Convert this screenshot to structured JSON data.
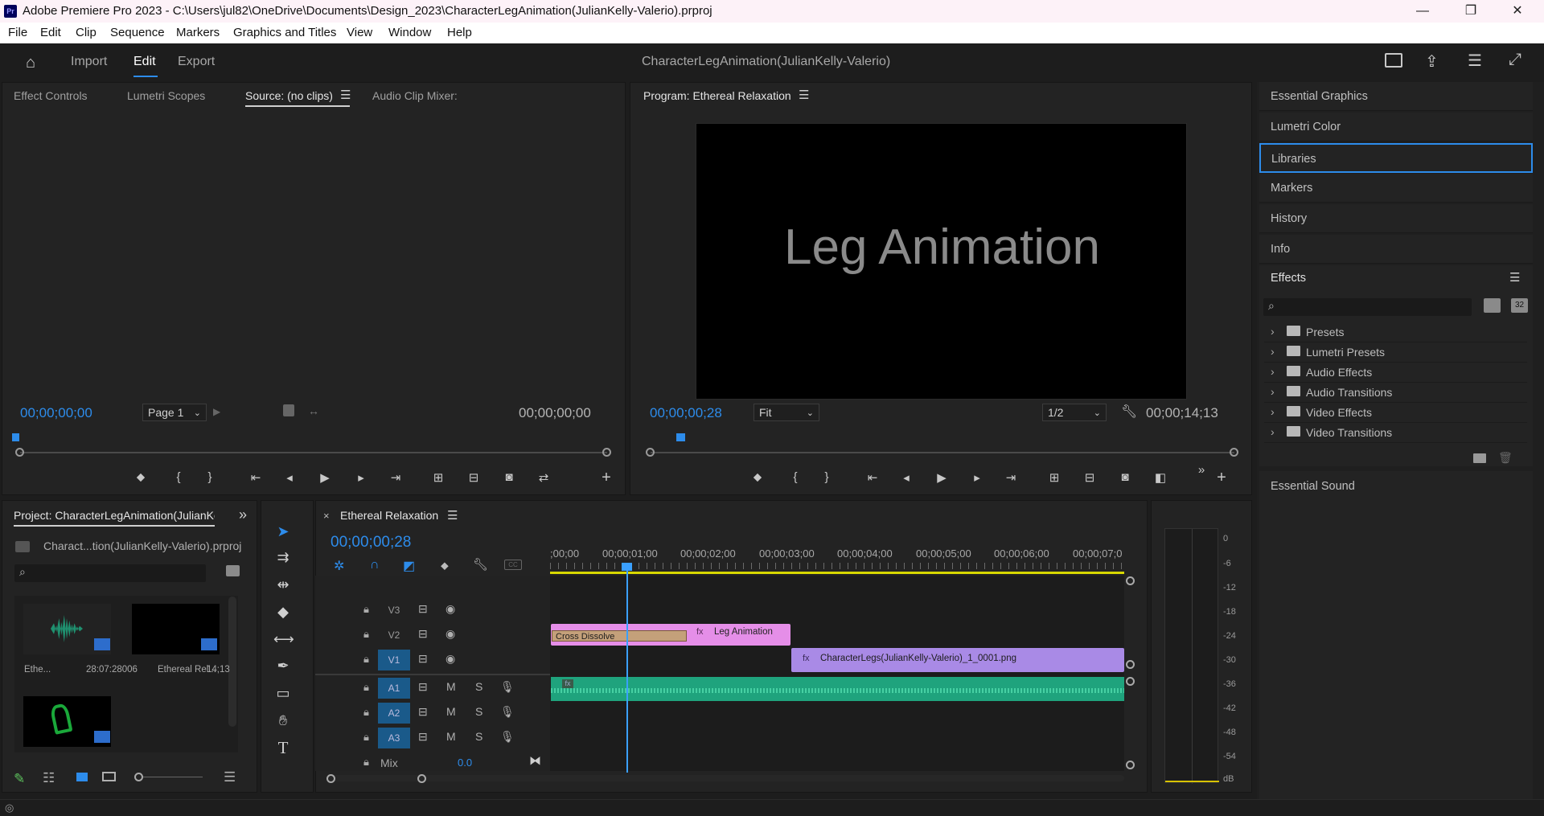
{
  "titlebar": {
    "app_icon": "Pr",
    "title": "Adobe Premiere Pro 2023 - C:\\Users\\jul82\\OneDrive\\Documents\\Design_2023\\CharacterLegAnimation(JulianKelly-Valerio).prproj",
    "minimize": "—",
    "restore": "❐",
    "close": "✕"
  },
  "menu": [
    "File",
    "Edit",
    "Clip",
    "Sequence",
    "Markers",
    "Graphics and Titles",
    "View",
    "Window",
    "Help"
  ],
  "header": {
    "import": "Import",
    "edit": "Edit",
    "export": "Export",
    "project_name": "CharacterLegAnimation(JulianKelly-Valerio)"
  },
  "source": {
    "tabs": [
      "Effect Controls",
      "Lumetri Scopes",
      "Source: (no clips)",
      "Audio Clip Mixer:"
    ],
    "tc_left": "00;00;00;00",
    "page": "Page 1",
    "tc_right": "00;00;00;00"
  },
  "program": {
    "title": "Program: Ethereal Relaxation",
    "preview_text": "Leg Animation",
    "tc_left": "00;00;00;28",
    "fit": "Fit",
    "resolution": "1/2",
    "tc_right": "00;00;14;13"
  },
  "right": {
    "items": [
      "Essential Graphics",
      "Lumetri Color",
      "Libraries",
      "Markers",
      "History",
      "Info"
    ],
    "effects_title": "Effects",
    "effects_list": [
      "Presets",
      "Lumetri Presets",
      "Audio Effects",
      "Audio Transitions",
      "Video Effects",
      "Video Transitions"
    ],
    "essential_sound": "Essential Sound"
  },
  "project": {
    "title": "Project: CharacterLegAnimation(JulianKe",
    "file": "Charact...tion(JulianKelly-Valerio).prproj",
    "items": [
      {
        "name": "Ethe...",
        "duration": "28:07:28006"
      },
      {
        "name": "Ethereal Rel...",
        "duration": "14;13"
      },
      {
        "name": "",
        "duration": ""
      }
    ]
  },
  "timeline": {
    "tab": "Ethereal Relaxation",
    "tc": "00;00;00;28",
    "ruler": [
      ";00;00",
      "00;00;01;00",
      "00;00;02;00",
      "00;00;03;00",
      "00;00;04;00",
      "00;00;05;00",
      "00;00;06;00",
      "00;00;07;0"
    ],
    "tracks": [
      {
        "name": "V3",
        "on": false
      },
      {
        "name": "V2",
        "on": false
      },
      {
        "name": "V1",
        "on": true
      },
      {
        "name": "A1",
        "on": true
      },
      {
        "name": "A2",
        "on": true
      },
      {
        "name": "A3",
        "on": true
      }
    ],
    "mix_label": "Mix",
    "mix_value": "0.0",
    "clips": {
      "cross_dissolve": "Cross Dissolve",
      "leg_animation": "Leg Animation",
      "character_legs": "CharacterLegs(JulianKelly-Valerio)_1_0001.png"
    }
  },
  "meter": {
    "scale": [
      "0",
      "-6",
      "-12",
      "-18",
      "-24",
      "-30",
      "-36",
      "-42",
      "-48",
      "-54",
      "dB"
    ]
  },
  "colors": {
    "accent": "#2d8ceb",
    "title_clip": "#e58ee8",
    "image_clip": "#a98ae6",
    "audio_clip": "#1fa37d",
    "playhead": "#3aa0ff"
  }
}
